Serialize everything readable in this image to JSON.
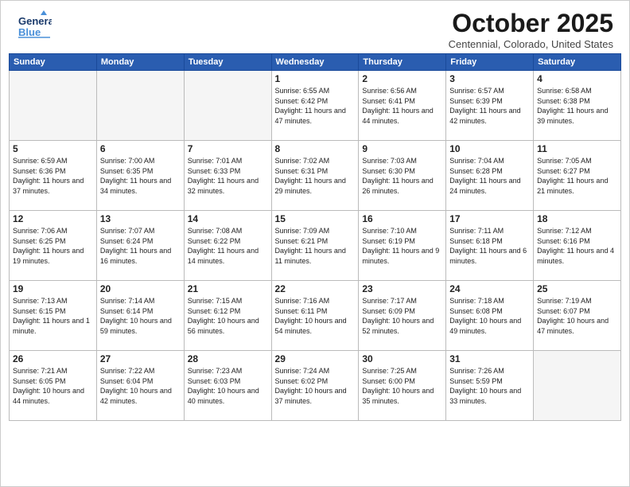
{
  "header": {
    "logo_general": "General",
    "logo_blue": "Blue",
    "month_title": "October 2025",
    "location": "Centennial, Colorado, United States"
  },
  "weekdays": [
    "Sunday",
    "Monday",
    "Tuesday",
    "Wednesday",
    "Thursday",
    "Friday",
    "Saturday"
  ],
  "weeks": [
    [
      {
        "day": "",
        "empty": true
      },
      {
        "day": "",
        "empty": true
      },
      {
        "day": "",
        "empty": true
      },
      {
        "day": "1",
        "sunrise": "6:55 AM",
        "sunset": "6:42 PM",
        "daylight": "11 hours and 47 minutes."
      },
      {
        "day": "2",
        "sunrise": "6:56 AM",
        "sunset": "6:41 PM",
        "daylight": "11 hours and 44 minutes."
      },
      {
        "day": "3",
        "sunrise": "6:57 AM",
        "sunset": "6:39 PM",
        "daylight": "11 hours and 42 minutes."
      },
      {
        "day": "4",
        "sunrise": "6:58 AM",
        "sunset": "6:38 PM",
        "daylight": "11 hours and 39 minutes."
      }
    ],
    [
      {
        "day": "5",
        "sunrise": "6:59 AM",
        "sunset": "6:36 PM",
        "daylight": "11 hours and 37 minutes."
      },
      {
        "day": "6",
        "sunrise": "7:00 AM",
        "sunset": "6:35 PM",
        "daylight": "11 hours and 34 minutes."
      },
      {
        "day": "7",
        "sunrise": "7:01 AM",
        "sunset": "6:33 PM",
        "daylight": "11 hours and 32 minutes."
      },
      {
        "day": "8",
        "sunrise": "7:02 AM",
        "sunset": "6:31 PM",
        "daylight": "11 hours and 29 minutes."
      },
      {
        "day": "9",
        "sunrise": "7:03 AM",
        "sunset": "6:30 PM",
        "daylight": "11 hours and 26 minutes."
      },
      {
        "day": "10",
        "sunrise": "7:04 AM",
        "sunset": "6:28 PM",
        "daylight": "11 hours and 24 minutes."
      },
      {
        "day": "11",
        "sunrise": "7:05 AM",
        "sunset": "6:27 PM",
        "daylight": "11 hours and 21 minutes."
      }
    ],
    [
      {
        "day": "12",
        "sunrise": "7:06 AM",
        "sunset": "6:25 PM",
        "daylight": "11 hours and 19 minutes."
      },
      {
        "day": "13",
        "sunrise": "7:07 AM",
        "sunset": "6:24 PM",
        "daylight": "11 hours and 16 minutes."
      },
      {
        "day": "14",
        "sunrise": "7:08 AM",
        "sunset": "6:22 PM",
        "daylight": "11 hours and 14 minutes."
      },
      {
        "day": "15",
        "sunrise": "7:09 AM",
        "sunset": "6:21 PM",
        "daylight": "11 hours and 11 minutes."
      },
      {
        "day": "16",
        "sunrise": "7:10 AM",
        "sunset": "6:19 PM",
        "daylight": "11 hours and 9 minutes."
      },
      {
        "day": "17",
        "sunrise": "7:11 AM",
        "sunset": "6:18 PM",
        "daylight": "11 hours and 6 minutes."
      },
      {
        "day": "18",
        "sunrise": "7:12 AM",
        "sunset": "6:16 PM",
        "daylight": "11 hours and 4 minutes."
      }
    ],
    [
      {
        "day": "19",
        "sunrise": "7:13 AM",
        "sunset": "6:15 PM",
        "daylight": "11 hours and 1 minute."
      },
      {
        "day": "20",
        "sunrise": "7:14 AM",
        "sunset": "6:14 PM",
        "daylight": "10 hours and 59 minutes."
      },
      {
        "day": "21",
        "sunrise": "7:15 AM",
        "sunset": "6:12 PM",
        "daylight": "10 hours and 56 minutes."
      },
      {
        "day": "22",
        "sunrise": "7:16 AM",
        "sunset": "6:11 PM",
        "daylight": "10 hours and 54 minutes."
      },
      {
        "day": "23",
        "sunrise": "7:17 AM",
        "sunset": "6:09 PM",
        "daylight": "10 hours and 52 minutes."
      },
      {
        "day": "24",
        "sunrise": "7:18 AM",
        "sunset": "6:08 PM",
        "daylight": "10 hours and 49 minutes."
      },
      {
        "day": "25",
        "sunrise": "7:19 AM",
        "sunset": "6:07 PM",
        "daylight": "10 hours and 47 minutes."
      }
    ],
    [
      {
        "day": "26",
        "sunrise": "7:21 AM",
        "sunset": "6:05 PM",
        "daylight": "10 hours and 44 minutes."
      },
      {
        "day": "27",
        "sunrise": "7:22 AM",
        "sunset": "6:04 PM",
        "daylight": "10 hours and 42 minutes."
      },
      {
        "day": "28",
        "sunrise": "7:23 AM",
        "sunset": "6:03 PM",
        "daylight": "10 hours and 40 minutes."
      },
      {
        "day": "29",
        "sunrise": "7:24 AM",
        "sunset": "6:02 PM",
        "daylight": "10 hours and 37 minutes."
      },
      {
        "day": "30",
        "sunrise": "7:25 AM",
        "sunset": "6:00 PM",
        "daylight": "10 hours and 35 minutes."
      },
      {
        "day": "31",
        "sunrise": "7:26 AM",
        "sunset": "5:59 PM",
        "daylight": "10 hours and 33 minutes."
      },
      {
        "day": "",
        "empty": true
      }
    ]
  ]
}
